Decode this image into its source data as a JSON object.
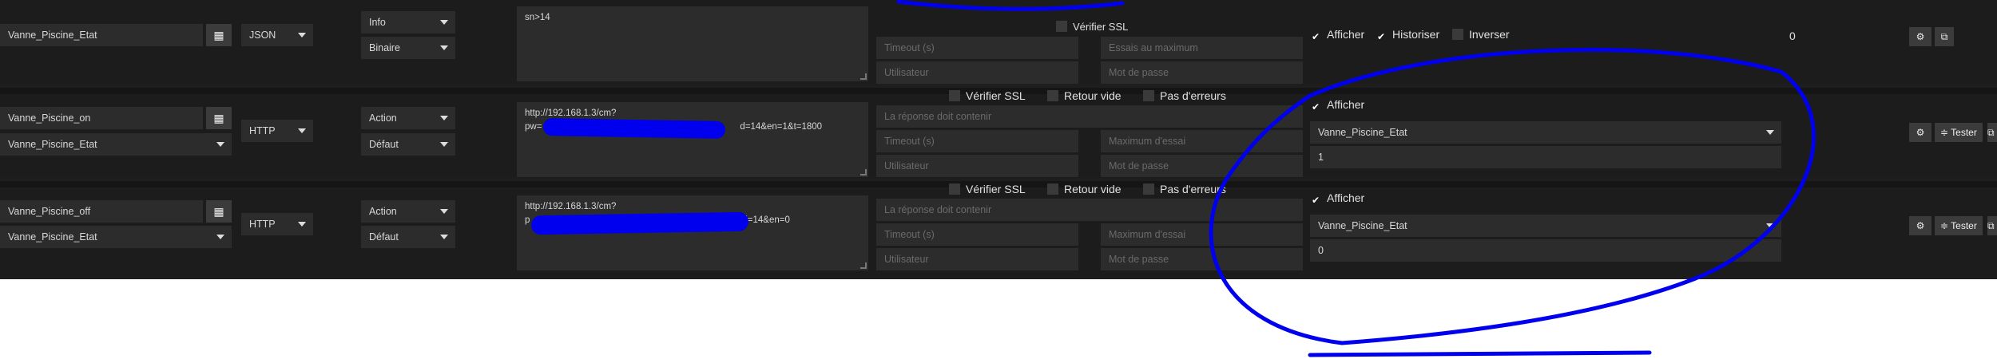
{
  "rows": [
    {
      "name": "Vanne_Piscine_Etat",
      "type": "JSON",
      "subtype": "Info",
      "subtype2": "Binaire",
      "request": "sn>14",
      "ssl_label": "Vérifier SSL",
      "timeout_ph": "Timeout (s)",
      "attempts_ph": "Essais au maximum",
      "user_ph": "Utilisateur",
      "pass_ph": "Mot de passe",
      "show_label": "Afficher",
      "historize_label": "Historiser",
      "invert_label": "Inverser",
      "value": "0"
    },
    {
      "name": "Vanne_Piscine_on",
      "linked": "Vanne_Piscine_Etat",
      "type": "HTTP",
      "subtype": "Action",
      "subtype2": "Défaut",
      "url_line1": "http://192.168.1.3/cm?",
      "url_line2_start": "pw=",
      "url_line2_end": "d=14&en=1&t=1800",
      "ssl_label": "Vérifier SSL",
      "empty_label": "Retour vide",
      "noerr_label": "Pas d'erreurs",
      "reply_ph": "La réponse doit contenir",
      "timeout_ph": "Timeout (s)",
      "max_ph": "Maximum d'essai",
      "user_ph": "Utilisateur",
      "pass_ph": "Mot de passe",
      "show_label": "Afficher",
      "state_select": "Vanne_Piscine_Etat",
      "state_value": "1",
      "test_label": "Tester"
    },
    {
      "name": "Vanne_Piscine_off",
      "linked": "Vanne_Piscine_Etat",
      "type": "HTTP",
      "subtype": "Action",
      "subtype2": "Défaut",
      "url_line1": "http://192.168.1.3/cm?",
      "url_line2_start": "p",
      "url_line2_end": "d=14&en=0",
      "ssl_label": "Vérifier SSL",
      "empty_label": "Retour vide",
      "noerr_label": "Pas d'erreurs",
      "reply_ph": "La réponse doit contenir",
      "timeout_ph": "Timeout (s)",
      "max_ph": "Maximum d'essai",
      "user_ph": "Utilisateur",
      "pass_ph": "Mot de passe",
      "show_label": "Afficher",
      "state_select": "Vanne_Piscine_Etat",
      "state_value": "0",
      "test_label": "Tester"
    }
  ],
  "icons": {
    "configure": "gears-icon",
    "copy": "copy-icon",
    "test": "rss-icon",
    "command_picker": "list-alt-icon"
  },
  "colors": {
    "annotation": "#0000ee",
    "panel": "#1c1c1c",
    "field": "#2c2c2c"
  }
}
